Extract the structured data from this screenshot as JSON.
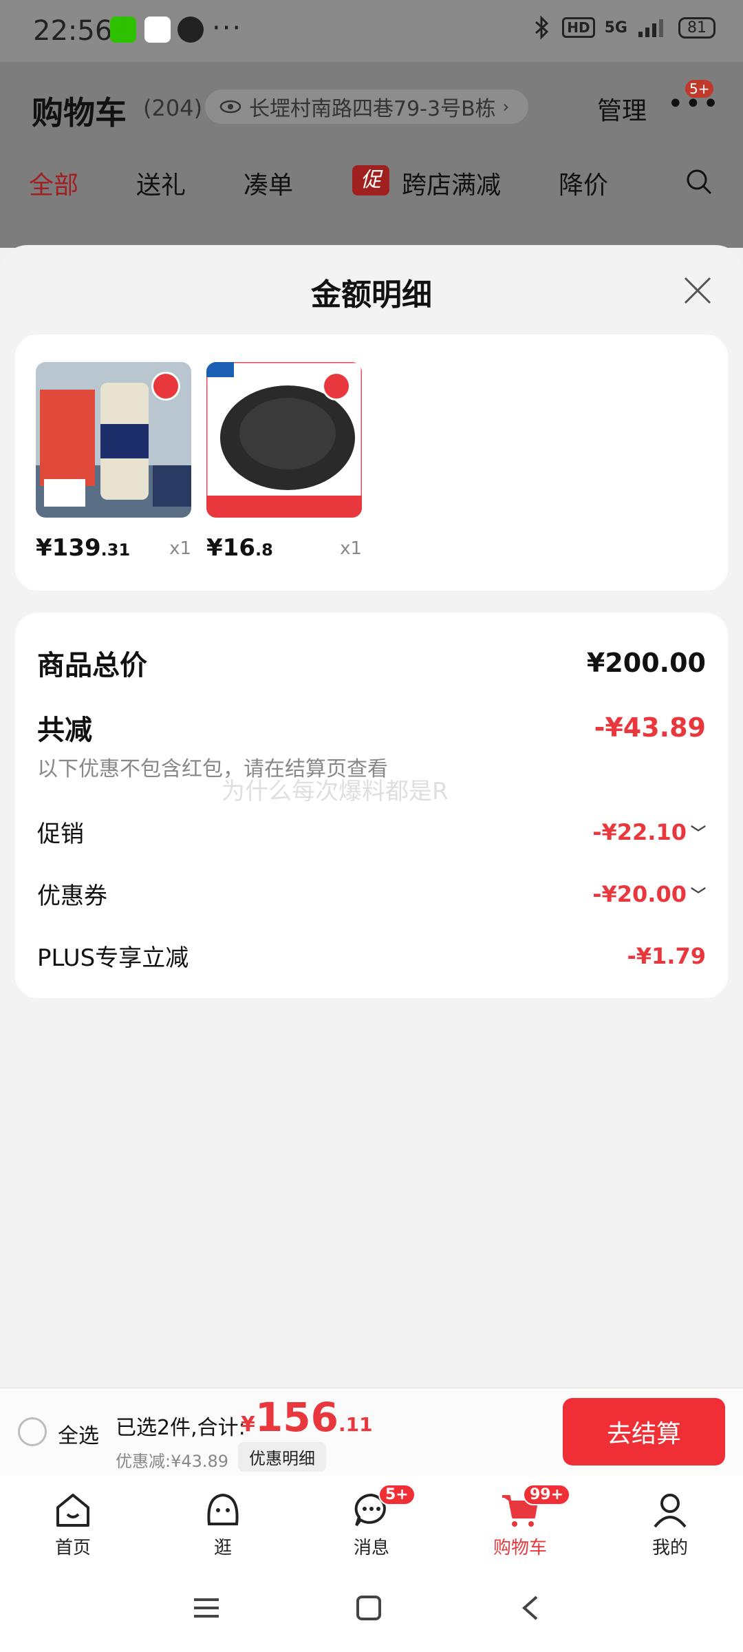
{
  "status_bar": {
    "time": "22:56",
    "network": "5G",
    "hd": "HD",
    "battery": "81",
    "icons": [
      "wechat-icon",
      "qq-icon",
      "clock-app-icon",
      "bluetooth-icon",
      "signal-icon"
    ]
  },
  "background": {
    "title": "购物车",
    "count": "(204)",
    "address": "长堽村南路四巷79-3号B栋",
    "manage": "管理",
    "more_badge": "5+",
    "tabs": [
      "全部",
      "送礼",
      "凑单",
      "跨店满减",
      "降价"
    ],
    "promo_tag": "促"
  },
  "sheet": {
    "title": "金额明细",
    "products": [
      {
        "price_int": "¥139",
        "price_dec": ".31",
        "qty": "x1",
        "image": "beer-can-product-image"
      },
      {
        "price_int": "¥16",
        "price_dec": ".8",
        "qty": "x1",
        "image": "lens-cap-product-image"
      }
    ],
    "summary": {
      "total_label": "商品总价",
      "total_value": "¥200.00",
      "reduce_label": "共减",
      "reduce_value": "-¥43.89",
      "note": "以下优惠不包含红包，请在结算页查看",
      "watermark": "为什么每次爆料都是R",
      "promo_label": "促销",
      "promo_value": "-¥22.10",
      "coupon_label": "优惠券",
      "coupon_value": "-¥20.00",
      "plus_label": "PLUS专享立减",
      "plus_value": "-¥1.79"
    }
  },
  "checkout": {
    "select_all": "全选",
    "selected_text": "已选2件,合计:",
    "total_sym": "¥",
    "total_int": "156",
    "total_dec": ".11",
    "discount_text": "优惠减:¥43.89",
    "detail_btn": "优惠明细",
    "checkout_btn": "去结算"
  },
  "nav": {
    "items": [
      {
        "label": "首页"
      },
      {
        "label": "逛"
      },
      {
        "label": "消息",
        "badge": "5+"
      },
      {
        "label": "购物车",
        "badge": "99+"
      },
      {
        "label": "我的"
      }
    ]
  },
  "colors": {
    "accent": "#e8383d",
    "button": "#ef2f35"
  }
}
